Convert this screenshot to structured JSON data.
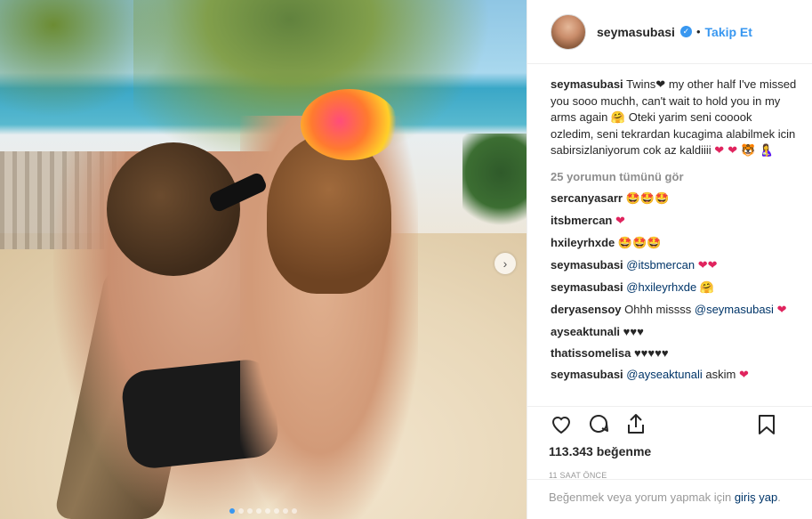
{
  "post": {
    "username": "seymasubasi",
    "separator": "•",
    "follow_label": "Takip Et",
    "caption_user": "seymasubasi",
    "caption_text": "Twins",
    "caption_rest": " my other half I've missed you sooo muchh, can't wait to hold you in my arms again ",
    "caption_turkish": " Oteki yarim seni cooook ozledim, seni tekrardan kucagima alabilmek icin sabirsizlaniyorum cok az kaldiiii ",
    "caption_emoji_end": "❤ ❤ 🐯 🤱",
    "hug_emoji": "🤗",
    "heart_black": "❤",
    "view_all": "25 yorumun tümünü gör"
  },
  "comments": [
    {
      "user": "sercanyasarr",
      "text": "",
      "mention": "",
      "emoji": "🤩🤩🤩"
    },
    {
      "user": "itsbmercan",
      "text": "",
      "mention": "",
      "emoji": "❤"
    },
    {
      "user": "hxileyrhxde",
      "text": "",
      "mention": "",
      "emoji": "🤩🤩🤩"
    },
    {
      "user": "seymasubasi",
      "text": "",
      "mention": "@itsbmercan",
      "emoji": "❤❤"
    },
    {
      "user": "seymasubasi",
      "text": "",
      "mention": "@hxileyrhxde",
      "emoji": "🤗"
    },
    {
      "user": "deryasensoy",
      "text": "Ohhh missss ",
      "mention": "@seymasubasi",
      "emoji": "❤"
    },
    {
      "user": "ayseaktunali",
      "text": "♥♥♥",
      "mention": "",
      "emoji": ""
    },
    {
      "user": "thatissomelisa",
      "text": "♥♥♥♥♥",
      "mention": "",
      "emoji": ""
    },
    {
      "user": "seymasubasi",
      "text": "",
      "mention": "@ayseaktunali",
      "emoji": "❤",
      "suffix": " askim"
    }
  ],
  "actions": {
    "likes": "113.343 beğenme",
    "time": "11 SAAT ÖNCE",
    "login_text": "Beğenmek veya yorum yapmak için ",
    "login_link": "giriş yap",
    "login_end": "."
  },
  "icons": [
    "heart-icon",
    "comment-icon",
    "share-icon",
    "bookmark-icon",
    "chevron-right-icon",
    "verified-icon"
  ],
  "colors": {
    "accent": "#3897f0",
    "heart": "#e0245e",
    "muted": "#8e8e8e"
  },
  "carousel": {
    "slides": 8,
    "active": 1
  }
}
